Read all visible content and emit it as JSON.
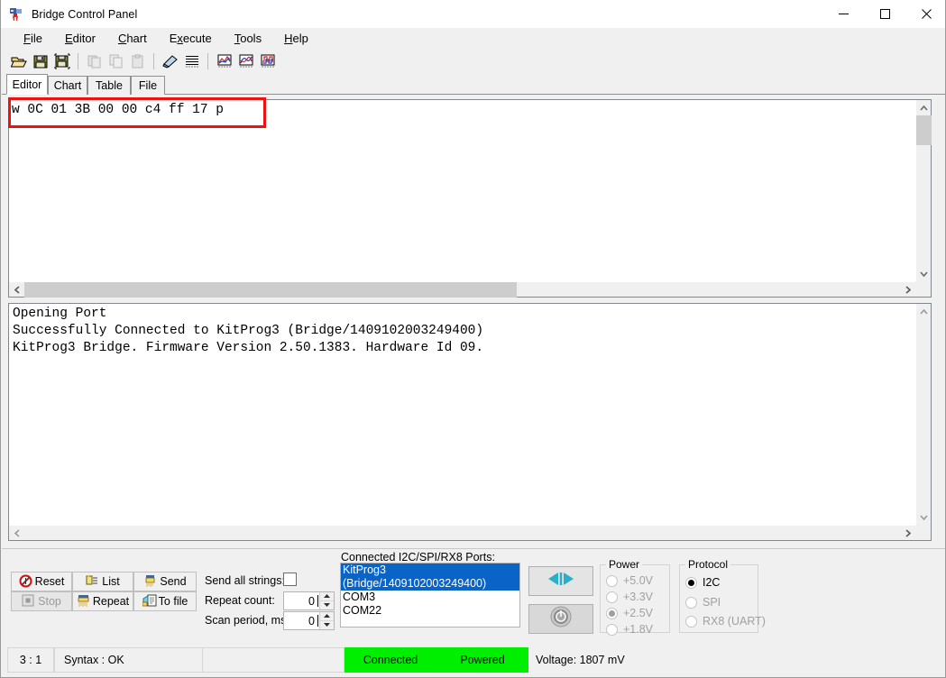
{
  "window": {
    "title": "Bridge Control Panel",
    "icon": "app-icon",
    "minimize": "─",
    "maximize": "□",
    "close": "✕"
  },
  "menu": {
    "items": [
      {
        "label": "File",
        "accel": "F"
      },
      {
        "label": "Editor",
        "accel": "E"
      },
      {
        "label": "Chart",
        "accel": "C"
      },
      {
        "label": "Execute",
        "accel": "x"
      },
      {
        "label": "Tools",
        "accel": "T"
      },
      {
        "label": "Help",
        "accel": "H"
      }
    ]
  },
  "toolbar": {
    "buttons": [
      {
        "name": "open-file-icon",
        "enabled": true
      },
      {
        "name": "save-file-icon",
        "enabled": true
      },
      {
        "name": "save-as-file-icon",
        "enabled": true
      },
      {
        "name": "cut-icon",
        "enabled": false
      },
      {
        "name": "copy-icon",
        "enabled": false
      },
      {
        "name": "paste-icon",
        "enabled": false
      },
      {
        "name": "clear-icon",
        "enabled": true
      },
      {
        "name": "list-view-icon",
        "enabled": true
      },
      {
        "name": "chart-line-icon",
        "enabled": true
      },
      {
        "name": "chart-curve-icon",
        "enabled": true
      },
      {
        "name": "chart-digital-icon",
        "enabled": true
      }
    ]
  },
  "tabs": {
    "items": [
      "Editor",
      "Chart",
      "Table",
      "File"
    ],
    "active": "Editor"
  },
  "editor": {
    "content": "w 0C 01 3B 00 00 c4 ff 17 p",
    "highlight_color": "#ee1111"
  },
  "log": {
    "lines": [
      "Opening Port",
      "Successfully Connected to KitProg3 (Bridge/1409102003249400)",
      "KitProg3 Bridge. Firmware Version 2.50.1383. Hardware Id 09."
    ]
  },
  "controls": {
    "reset_label": "Reset",
    "list_label": "List",
    "send_label": "Send",
    "stop_label": "Stop",
    "repeat_label": "Repeat",
    "tofile_label": "To file",
    "send_all_strings_label": "Send all strings:",
    "send_all_strings_checked": false,
    "repeat_count_label": "Repeat count:",
    "repeat_count_value": "0",
    "scan_period_label": "Scan period, ms:",
    "scan_period_value": "0"
  },
  "ports": {
    "title": "Connected I2C/SPI/RX8 Ports:",
    "items": [
      {
        "label": "KitProg3 (Bridge/1409102003249400)",
        "selected": true
      },
      {
        "label": "COM3",
        "selected": false
      },
      {
        "label": "COM22",
        "selected": false
      }
    ]
  },
  "power": {
    "title": "Power",
    "options": [
      {
        "label": "+5.0V",
        "selected": false,
        "enabled": false
      },
      {
        "label": "+3.3V",
        "selected": false,
        "enabled": false
      },
      {
        "label": "+2.5V",
        "selected": true,
        "enabled": false
      },
      {
        "label": "+1.8V",
        "selected": false,
        "enabled": false
      }
    ]
  },
  "protocol": {
    "title": "Protocol",
    "options": [
      {
        "label": "I2C",
        "selected": true,
        "enabled": true
      },
      {
        "label": "SPI",
        "selected": false,
        "enabled": false
      },
      {
        "label": "RX8 (UART)",
        "selected": false,
        "enabled": false
      }
    ]
  },
  "actions": {
    "connect_icon": "connect-arrows-icon",
    "power_icon": "power-button-icon"
  },
  "status": {
    "position": "3 : 1",
    "syntax": "Syntax : OK",
    "blank": "",
    "connected": "Connected",
    "powered": "Powered",
    "voltage": "Voltage: 1807 mV",
    "green": "#00ee00"
  }
}
